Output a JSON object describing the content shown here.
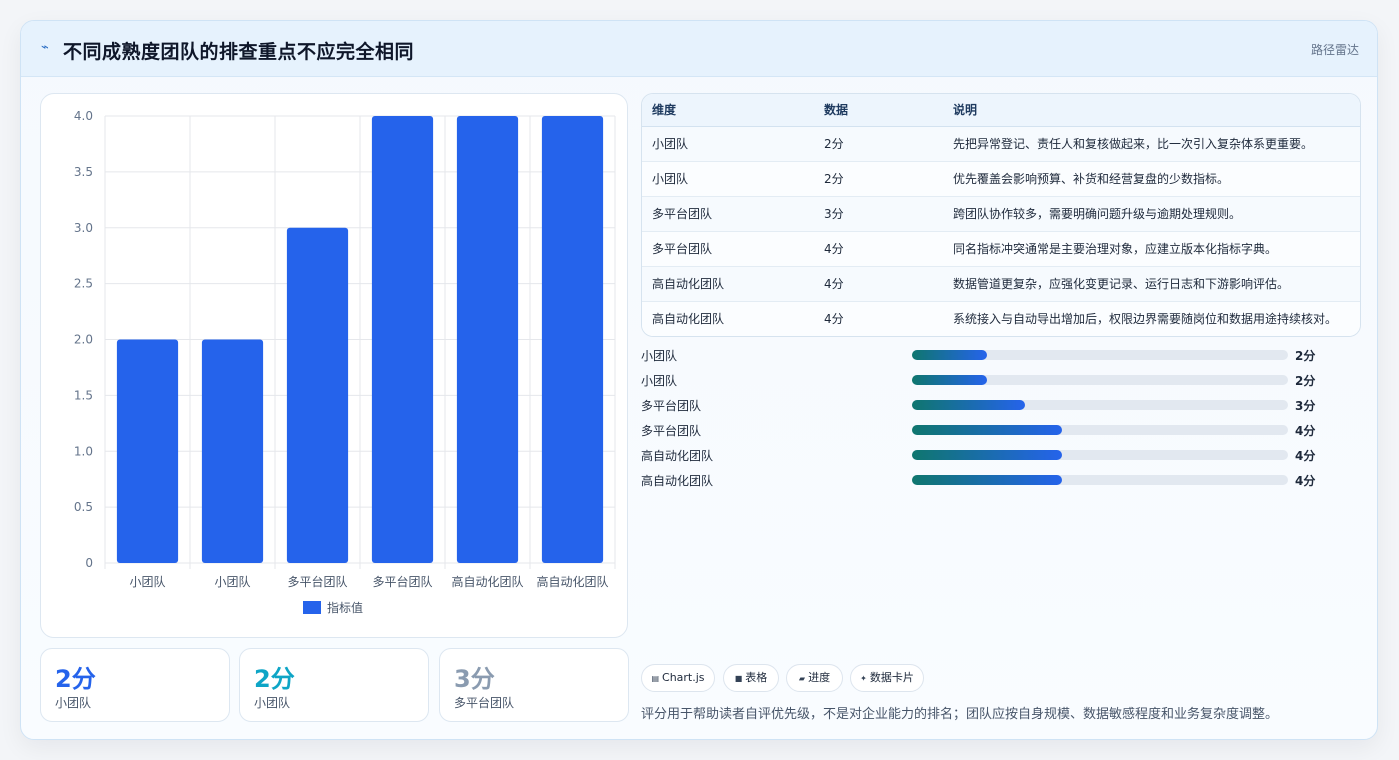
{
  "header": {
    "icon": "chart-spark-icon",
    "title": "不同成熟度团队的排查重点不应完全相同",
    "tag": "路径雷达"
  },
  "chart_data": {
    "type": "bar",
    "categories": [
      "小团队",
      "小团队",
      "多平台团队",
      "多平台团队",
      "高自动化团队",
      "高自动化团队"
    ],
    "series": [
      {
        "name": "指标值",
        "values": [
          2,
          2,
          3,
          4,
          4,
          4
        ]
      }
    ],
    "ylim": [
      0,
      4
    ],
    "yticks": [
      "0",
      "0.5",
      "1.0",
      "1.5",
      "2.0",
      "2.5",
      "3.0",
      "3.5",
      "4.0"
    ],
    "grid": true,
    "legend_position": "bottom",
    "bar_color": "#2563eb"
  },
  "stats": [
    {
      "value": "2分",
      "label": "小团队",
      "color": "#2563eb"
    },
    {
      "value": "2分",
      "label": "小团队",
      "color": "#0ea5c6"
    },
    {
      "value": "3分",
      "label": "多平台团队",
      "color": "#8a9bb0"
    }
  ],
  "table": {
    "headers": [
      "维度",
      "数据",
      "说明"
    ],
    "rows": [
      {
        "dim": "小团队",
        "data": "2分",
        "desc": "先把异常登记、责任人和复核做起来，比一次引入复杂体系更重要。"
      },
      {
        "dim": "小团队",
        "data": "2分",
        "desc": "优先覆盖会影响预算、补货和经营复盘的少数指标。"
      },
      {
        "dim": "多平台团队",
        "data": "3分",
        "desc": "跨团队协作较多，需要明确问题升级与逾期处理规则。"
      },
      {
        "dim": "多平台团队",
        "data": "4分",
        "desc": "同名指标冲突通常是主要治理对象，应建立版本化指标字典。"
      },
      {
        "dim": "高自动化团队",
        "data": "4分",
        "desc": "数据管道更复杂，应强化变更记录、运行日志和下游影响评估。"
      },
      {
        "dim": "高自动化团队",
        "data": "4分",
        "desc": "系统接入与自动导出增加后，权限边界需要随岗位和数据用途持续核对。"
      }
    ]
  },
  "progress": {
    "max": 10,
    "items": [
      {
        "label": "小团队",
        "value": 2,
        "text": "2分"
      },
      {
        "label": "小团队",
        "value": 2,
        "text": "2分"
      },
      {
        "label": "多平台团队",
        "value": 3,
        "text": "3分"
      },
      {
        "label": "多平台团队",
        "value": 4,
        "text": "4分"
      },
      {
        "label": "高自动化团队",
        "value": 4,
        "text": "4分"
      },
      {
        "label": "高自动化团队",
        "value": 4,
        "text": "4分"
      }
    ]
  },
  "chips": [
    {
      "icon": "chart-icon",
      "glyph": "▤",
      "label": "Chart.js"
    },
    {
      "icon": "table-icon",
      "glyph": "■",
      "label": "表格"
    },
    {
      "icon": "progress-icon",
      "glyph": "▰",
      "label": "进度"
    },
    {
      "icon": "card-icon",
      "glyph": "✦",
      "label": "数据卡片"
    }
  ],
  "footnote": "评分用于帮助读者自评优先级，不是对企业能力的排名；团队应按自身规模、数据敏感程度和业务复杂度调整。"
}
